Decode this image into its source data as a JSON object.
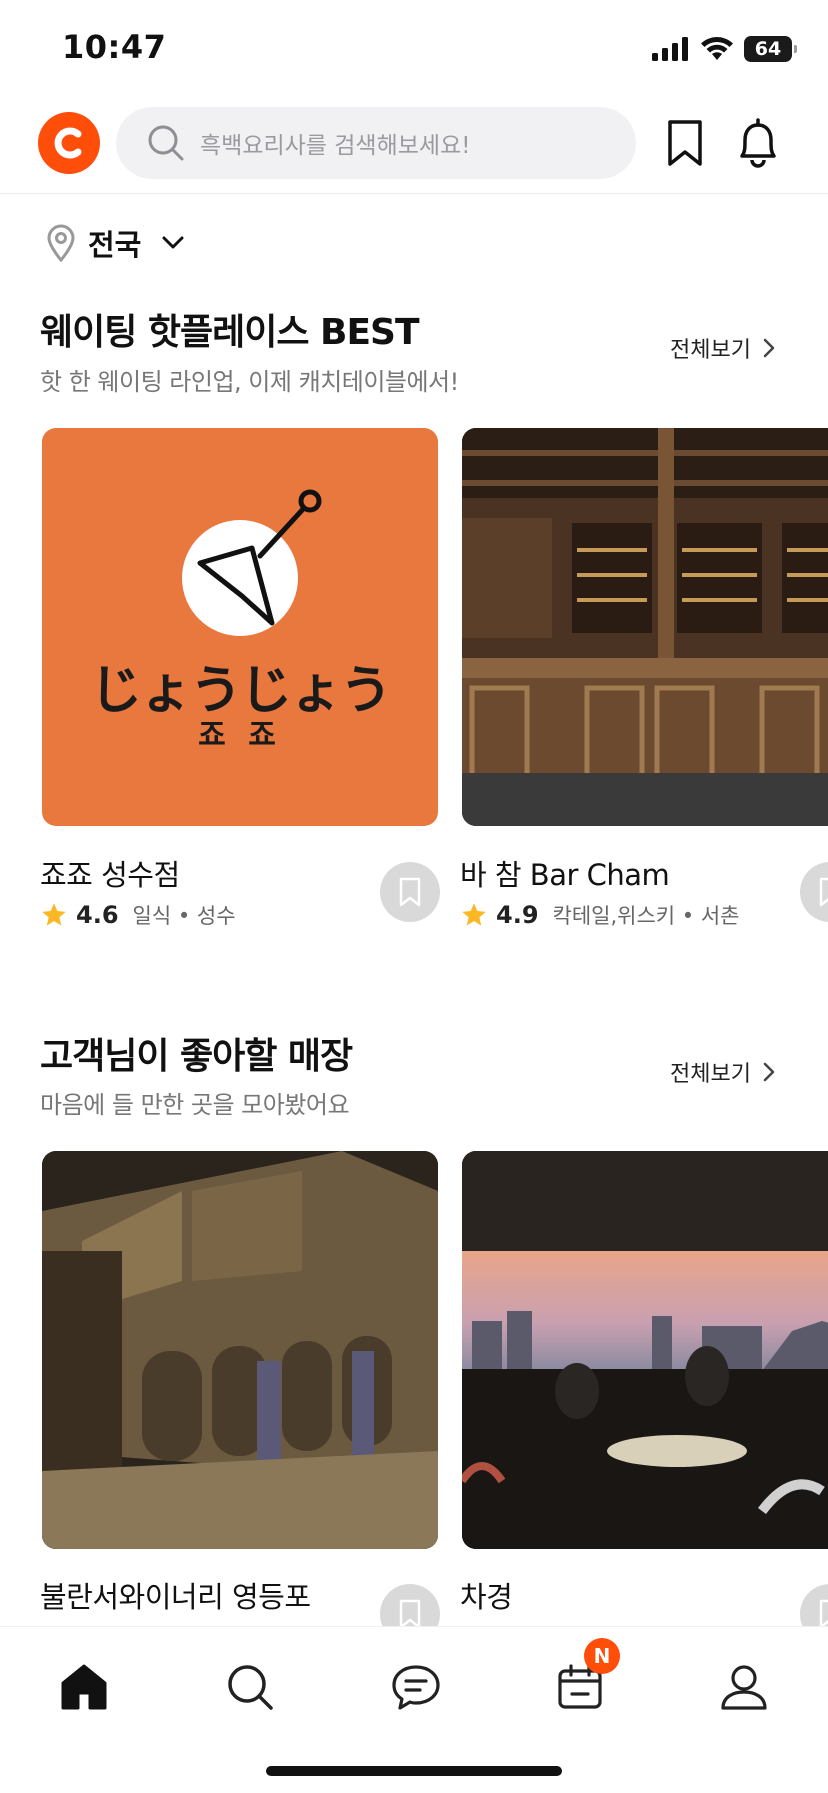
{
  "status_bar": {
    "time": "10:47",
    "battery": "64"
  },
  "header": {
    "logo_letter": "C",
    "search_placeholder": "흑백요리사를 검색해보세요!",
    "icons": [
      "search-icon",
      "bookmark-icon",
      "bell-icon"
    ]
  },
  "location": {
    "label": "전국"
  },
  "sections": [
    {
      "title": "웨이팅 핫플레이스 BEST",
      "subtitle": "핫 한 웨이팅 라인업, 이제 캐치테이블에서!",
      "see_all": "전체보기",
      "cards": [
        {
          "name": "죠죠 성수점",
          "rating": "4.6",
          "meta": "일식 • 성수",
          "logo_text": "じょうじょう",
          "logo_sub": "죠 죠"
        },
        {
          "name": "바 참 Bar Cham",
          "rating": "4.9",
          "meta": "칵테일,위스키 • 서촌"
        }
      ]
    },
    {
      "title": "고객님이 좋아할 매장",
      "subtitle": "마음에 들 만한 곳을 모아봤어요",
      "see_all": "전체보기",
      "cards": [
        {
          "name": "불란서와이너리 영등포"
        },
        {
          "name": "차경"
        }
      ]
    }
  ],
  "bottom_nav": {
    "items": [
      "home-icon",
      "search-icon",
      "chat-icon",
      "calendar-icon",
      "profile-icon"
    ],
    "badge": "N"
  },
  "colors": {
    "brand": "#ff4d0a",
    "star": "#fbb824",
    "card1_bg": "#e9783e"
  }
}
